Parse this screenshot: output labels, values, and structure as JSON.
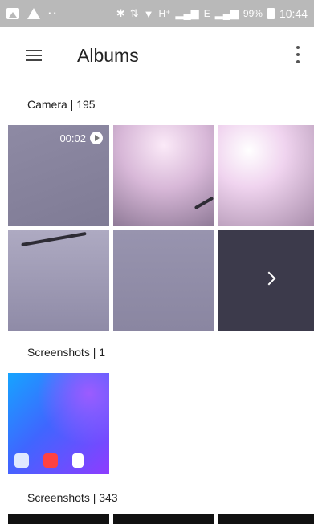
{
  "status_bar": {
    "network_text": "H⁺",
    "network2_text": "E",
    "battery": "99%",
    "time": "10:44"
  },
  "app_bar": {
    "title": "Albums"
  },
  "sections": [
    {
      "label": "Camera | 195",
      "video_duration": "00:02"
    },
    {
      "label": "Screenshots | 1"
    },
    {
      "label": "Screenshots | 343"
    }
  ]
}
